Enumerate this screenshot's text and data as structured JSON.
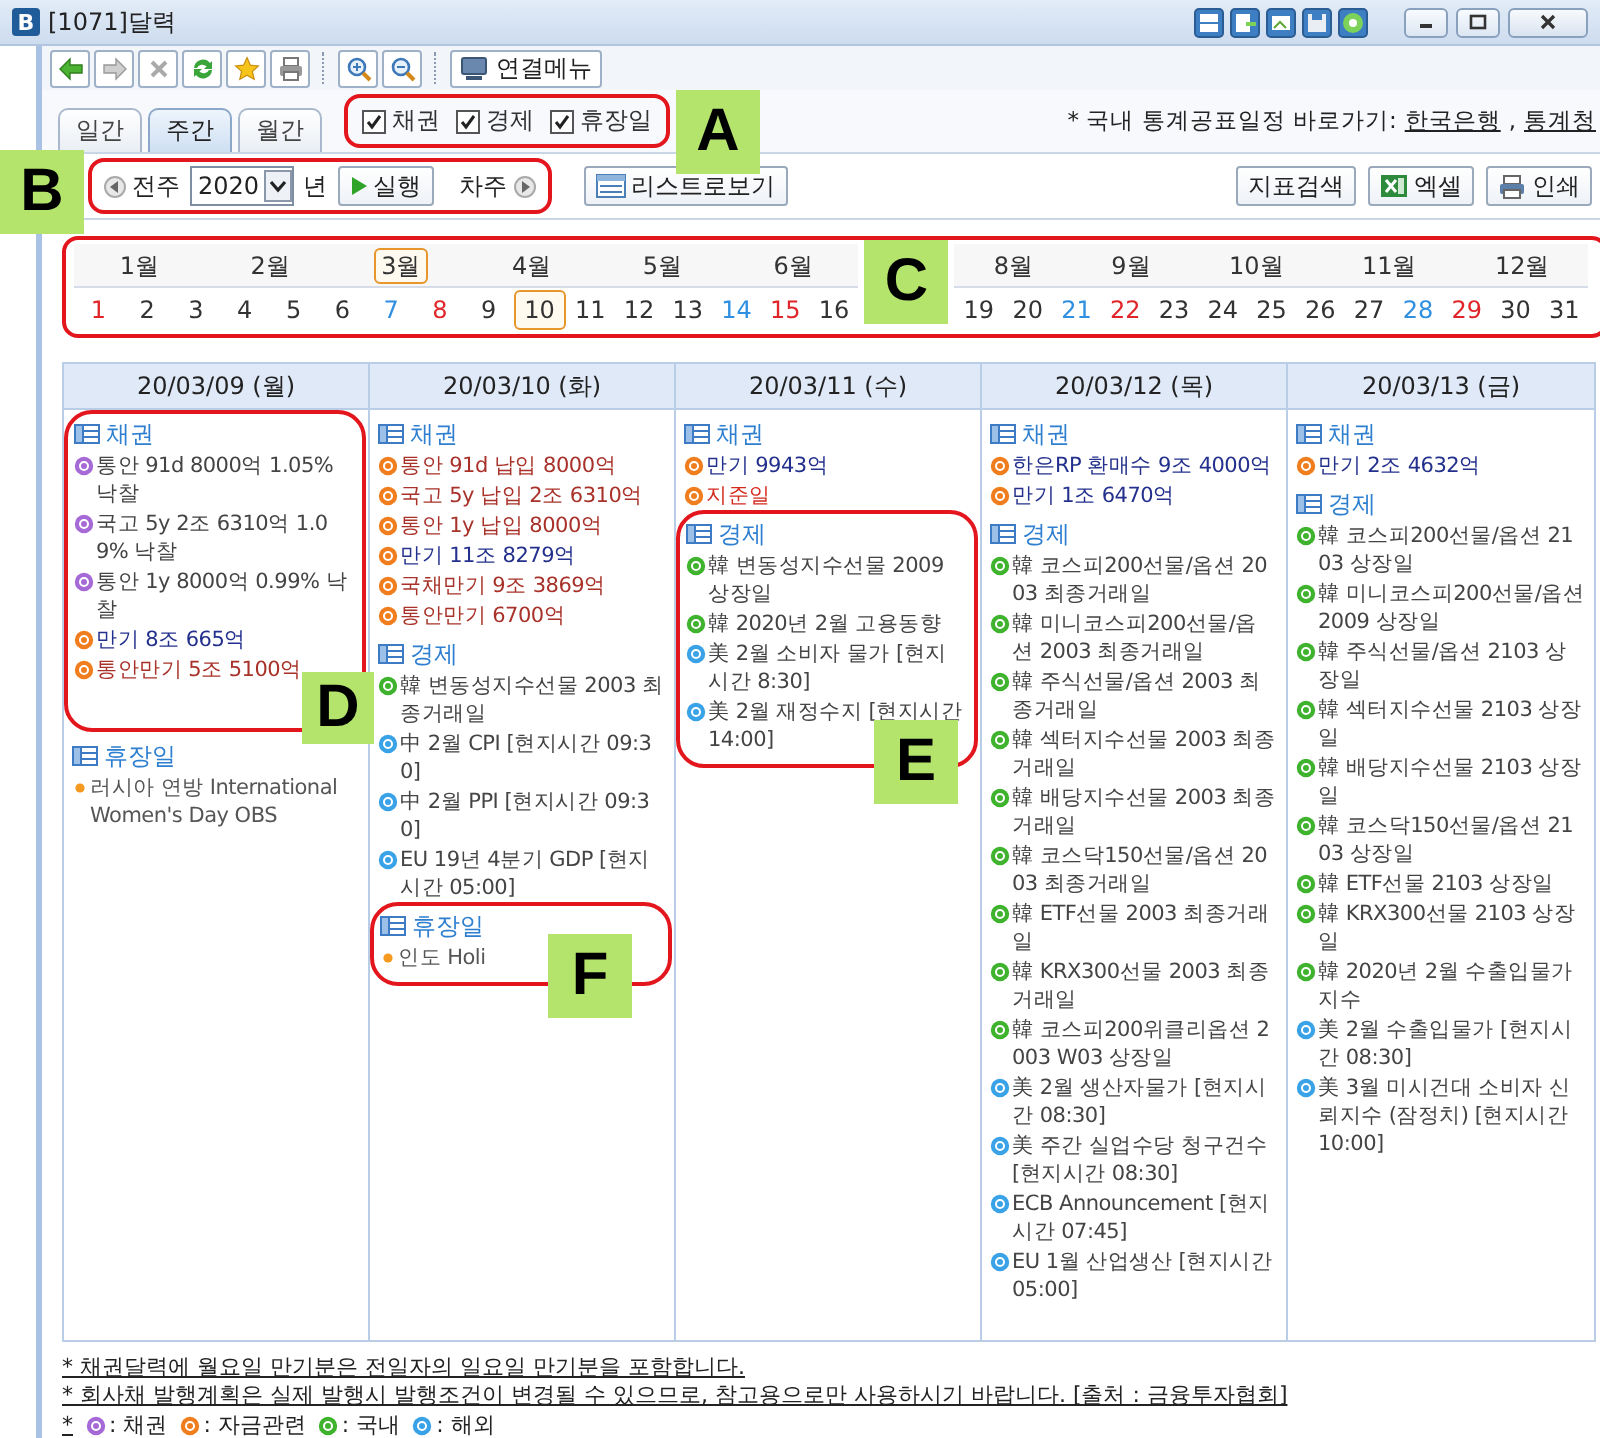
{
  "window": {
    "app_badge": "B",
    "title": "[1071]달력"
  },
  "toolbar": {
    "menu_button": "연결메뉴"
  },
  "view_tabs": [
    {
      "label": "일간",
      "selected": false
    },
    {
      "label": "주간",
      "selected": true
    },
    {
      "label": "월간",
      "selected": false
    }
  ],
  "filters": {
    "callout": "A",
    "options": [
      {
        "label": "채권",
        "checked": true
      },
      {
        "label": "경제",
        "checked": true
      },
      {
        "label": "휴장일",
        "checked": true
      }
    ]
  },
  "quick_links": {
    "prefix": "* 국내 통계공표일정 바로가기:",
    "links": [
      "한국은행",
      "통계청"
    ],
    "separator": ","
  },
  "navigation": {
    "callout": "B",
    "prev": "전주",
    "year": "2020",
    "year_unit": "년",
    "run": "실행",
    "next": "차주",
    "list_view": "리스트로보기",
    "search": "지표검색",
    "excel": "엑셀",
    "print": "인쇄"
  },
  "month_strip": {
    "callout": "C",
    "months_left": [
      {
        "label": "1월",
        "selected": false
      },
      {
        "label": "2월",
        "selected": false
      },
      {
        "label": "3월",
        "selected": true
      },
      {
        "label": "4월",
        "selected": false
      },
      {
        "label": "5월",
        "selected": false
      },
      {
        "label": "6월",
        "selected": false
      }
    ],
    "months_right": [
      {
        "label": "8월",
        "selected": false
      },
      {
        "label": "9월",
        "selected": false
      },
      {
        "label": "10월",
        "selected": false
      },
      {
        "label": "11월",
        "selected": false
      },
      {
        "label": "12월",
        "selected": false
      }
    ],
    "days_left": [
      {
        "label": "1",
        "kind": "sunday",
        "selected": false
      },
      {
        "label": "2",
        "kind": "weekday",
        "selected": false
      },
      {
        "label": "3",
        "kind": "weekday",
        "selected": false
      },
      {
        "label": "4",
        "kind": "weekday",
        "selected": false
      },
      {
        "label": "5",
        "kind": "weekday",
        "selected": false
      },
      {
        "label": "6",
        "kind": "weekday",
        "selected": false
      },
      {
        "label": "7",
        "kind": "saturday",
        "selected": false
      },
      {
        "label": "8",
        "kind": "sunday",
        "selected": false
      },
      {
        "label": "9",
        "kind": "weekday",
        "selected": false
      },
      {
        "label": "10",
        "kind": "weekday",
        "selected": true
      },
      {
        "label": "11",
        "kind": "weekday",
        "selected": false
      },
      {
        "label": "12",
        "kind": "weekday",
        "selected": false
      },
      {
        "label": "13",
        "kind": "weekday",
        "selected": false
      },
      {
        "label": "14",
        "kind": "saturday",
        "selected": false
      },
      {
        "label": "15",
        "kind": "sunday",
        "selected": false
      },
      {
        "label": "16",
        "kind": "weekday",
        "selected": false
      }
    ],
    "days_right": [
      {
        "label": "19",
        "kind": "weekday",
        "selected": false
      },
      {
        "label": "20",
        "kind": "weekday",
        "selected": false
      },
      {
        "label": "21",
        "kind": "saturday",
        "selected": false
      },
      {
        "label": "22",
        "kind": "sunday",
        "selected": false
      },
      {
        "label": "23",
        "kind": "weekday",
        "selected": false
      },
      {
        "label": "24",
        "kind": "weekday",
        "selected": false
      },
      {
        "label": "25",
        "kind": "weekday",
        "selected": false
      },
      {
        "label": "26",
        "kind": "weekday",
        "selected": false
      },
      {
        "label": "27",
        "kind": "weekday",
        "selected": false
      },
      {
        "label": "28",
        "kind": "saturday",
        "selected": false
      },
      {
        "label": "29",
        "kind": "sunday",
        "selected": false
      },
      {
        "label": "30",
        "kind": "weekday",
        "selected": false
      },
      {
        "label": "31",
        "kind": "weekday",
        "selected": false
      }
    ]
  },
  "week": [
    {
      "date": "20/03/09 (월)",
      "sections": [
        {
          "title": "채권",
          "callout": "D",
          "items": [
            {
              "kind": "bond",
              "text": "통안 91d 8000억 1.05% 낙찰",
              "color": "#444444"
            },
            {
              "kind": "bond",
              "text": "국고 5y 2조 6310억 1.09% 낙찰",
              "color": "#444444"
            },
            {
              "kind": "bond",
              "text": "통안 1y 8000억 0.99% 낙찰",
              "color": "#444444"
            },
            {
              "kind": "money",
              "text": "만기 8조 665억",
              "color": "#23308c"
            },
            {
              "kind": "money",
              "text": "통안만기 5조 5100억",
              "color": "#a8322a"
            }
          ]
        },
        {
          "title": "휴장일",
          "items": [
            {
              "kind": "holiday",
              "text": "러시아 연방 International Women's Day OBS",
              "color": "#555555"
            }
          ]
        }
      ]
    },
    {
      "date": "20/03/10 (화)",
      "sections": [
        {
          "title": "채권",
          "items": [
            {
              "kind": "money",
              "text": "통안 91d 납입 8000억",
              "color": "#a8322a"
            },
            {
              "kind": "money",
              "text": "국고 5y 납입 2조 6310억",
              "color": "#a8322a"
            },
            {
              "kind": "money",
              "text": "통안 1y 납입 8000억",
              "color": "#a8322a"
            },
            {
              "kind": "money",
              "text": "만기 11조 8279억",
              "color": "#23308c"
            },
            {
              "kind": "money",
              "text": "국채만기 9조 3869억",
              "color": "#a8322a"
            },
            {
              "kind": "money",
              "text": "통안만기 6700억",
              "color": "#a8322a"
            }
          ]
        },
        {
          "title": "경제",
          "items": [
            {
              "kind": "domestic",
              "text": "韓 변동성지수선물 2003 최종거래일",
              "color": "#444444"
            },
            {
              "kind": "foreign",
              "text": "中 2월 CPI [현지시간 09:30]",
              "color": "#444444"
            },
            {
              "kind": "foreign",
              "text": "中 2월 PPI [현지시간 09:30]",
              "color": "#444444"
            },
            {
              "kind": "foreign",
              "text": "EU 19년 4분기 GDP [현지시간 05:00]",
              "color": "#444444"
            }
          ]
        },
        {
          "title": "휴장일",
          "callout": "F",
          "items": [
            {
              "kind": "holiday",
              "text": "인도 Holi",
              "color": "#555555"
            }
          ]
        }
      ]
    },
    {
      "date": "20/03/11 (수)",
      "sections": [
        {
          "title": "채권",
          "items": [
            {
              "kind": "money",
              "text": "만기 9943억",
              "color": "#23308c"
            },
            {
              "kind": "money",
              "text": "지준일",
              "color": "#d42a1e"
            }
          ]
        },
        {
          "title": "경제",
          "callout": "E",
          "items": [
            {
              "kind": "domestic",
              "text": "韓 변동성지수선물 2009 상장일",
              "color": "#444444"
            },
            {
              "kind": "domestic",
              "text": "韓 2020년 2월 고용동향",
              "color": "#444444"
            },
            {
              "kind": "foreign",
              "text": "美 2월 소비자 물가 [현지시간 8:30]",
              "color": "#444444"
            },
            {
              "kind": "foreign",
              "text": "美 2월 재정수지 [현지시간 14:00]",
              "color": "#444444"
            }
          ]
        }
      ]
    },
    {
      "date": "20/03/12 (목)",
      "sections": [
        {
          "title": "채권",
          "items": [
            {
              "kind": "money",
              "text": "한은RP 환매수 9조 4000억",
              "color": "#23308c"
            },
            {
              "kind": "money",
              "text": "만기 1조 6470억",
              "color": "#23308c"
            }
          ]
        },
        {
          "title": "경제",
          "items": [
            {
              "kind": "domestic",
              "text": "韓 코스피200선물/옵션 2003 최종거래일",
              "color": "#444444"
            },
            {
              "kind": "domestic",
              "text": "韓 미니코스피200선물/옵션 2003 최종거래일",
              "color": "#444444"
            },
            {
              "kind": "domestic",
              "text": "韓 주식선물/옵션 2003 최종거래일",
              "color": "#444444"
            },
            {
              "kind": "domestic",
              "text": "韓 섹터지수선물 2003 최종거래일",
              "color": "#444444"
            },
            {
              "kind": "domestic",
              "text": "韓 배당지수선물 2003 최종거래일",
              "color": "#444444"
            },
            {
              "kind": "domestic",
              "text": "韓 코스닥150선물/옵션 2003 최종거래일",
              "color": "#444444"
            },
            {
              "kind": "domestic",
              "text": "韓 ETF선물 2003 최종거래일",
              "color": "#444444"
            },
            {
              "kind": "domestic",
              "text": "韓 KRX300선물 2003 최종거래일",
              "color": "#444444"
            },
            {
              "kind": "domestic",
              "text": "韓 코스피200위클리옵션 2003 W03 상장일",
              "color": "#444444"
            },
            {
              "kind": "foreign",
              "text": "美 2월 생산자물가 [현지시간 08:30]",
              "color": "#444444"
            },
            {
              "kind": "foreign",
              "text": "美 주간 실업수당 청구건수 [현지시간 08:30]",
              "color": "#444444"
            },
            {
              "kind": "foreign",
              "text": "ECB Announcement [현지시간 07:45]",
              "color": "#444444"
            },
            {
              "kind": "foreign",
              "text": "EU 1월 산업생산 [현지시간 05:00]",
              "color": "#444444"
            }
          ]
        }
      ]
    },
    {
      "date": "20/03/13 (금)",
      "sections": [
        {
          "title": "채권",
          "items": [
            {
              "kind": "money",
              "text": "만기 2조 4632억",
              "color": "#23308c"
            }
          ]
        },
        {
          "title": "경제",
          "items": [
            {
              "kind": "domestic",
              "text": "韓 코스피200선물/옵션 2103 상장일",
              "color": "#444444"
            },
            {
              "kind": "domestic",
              "text": "韓 미니코스피200선물/옵션 2009 상장일",
              "color": "#444444"
            },
            {
              "kind": "domestic",
              "text": "韓 주식선물/옵션 2103 상장일",
              "color": "#444444"
            },
            {
              "kind": "domestic",
              "text": "韓 섹터지수선물 2103 상장일",
              "color": "#444444"
            },
            {
              "kind": "domestic",
              "text": "韓 배당지수선물 2103 상장일",
              "color": "#444444"
            },
            {
              "kind": "domestic",
              "text": "韓 코스닥150선물/옵션 2103 상장일",
              "color": "#444444"
            },
            {
              "kind": "domestic",
              "text": "韓 ETF선물 2103 상장일",
              "color": "#444444"
            },
            {
              "kind": "domestic",
              "text": "韓 KRX300선물 2103 상장일",
              "color": "#444444"
            },
            {
              "kind": "domestic",
              "text": "韓 2020년 2월 수출입물가지수",
              "color": "#444444"
            },
            {
              "kind": "foreign",
              "text": "美 2월 수출입물가 [현지시간 08:30]",
              "color": "#444444"
            },
            {
              "kind": "foreign",
              "text": "美 3월 미시건대 소비자 신뢰지수 (잠정치) [현지시간 10:00]",
              "color": "#444444"
            }
          ]
        }
      ]
    }
  ],
  "footnotes": [
    "* 채권달력에 월요일 만기분은 전일자의 일요일 만기분을 포함합니다.",
    "* 회사채 발행계획은 실제 발행시 발행조건이 변경될 수 있으므로, 참고용으로만 사용하시기 바랍니다. [출처 : 금융투자협회]"
  ],
  "legend": {
    "prefix": "*",
    "items": [
      {
        "kind": "bond",
        "label": ": 채권"
      },
      {
        "kind": "money",
        "label": ": 자금관련"
      },
      {
        "kind": "domestic",
        "label": ": 국내"
      },
      {
        "kind": "foreign",
        "label": ": 해외"
      }
    ]
  }
}
